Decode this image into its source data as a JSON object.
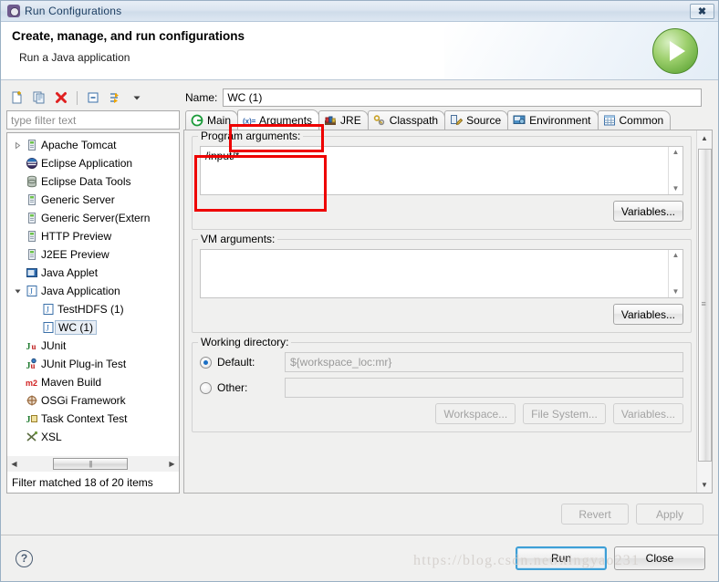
{
  "window": {
    "title": "Run Configurations",
    "close_label": "✖",
    "app_icon": "gear-icon"
  },
  "banner": {
    "title": "Create, manage, and run configurations",
    "subtitle": "Run a Java application",
    "badge_icon": "run-play-icon"
  },
  "tree_toolbar": {
    "buttons": [
      {
        "name": "new-configuration-button",
        "icon": "new-document-icon"
      },
      {
        "name": "duplicate-configuration-button",
        "icon": "copy-icon"
      },
      {
        "name": "delete-configuration-button",
        "icon": "delete-x-icon"
      },
      {
        "name": "collapse-all-button",
        "icon": "collapse-all-icon"
      },
      {
        "name": "filter-button",
        "icon": "filter-arrow-icon"
      },
      {
        "name": "view-menu-button",
        "icon": "chevron-down-icon"
      }
    ]
  },
  "filter": {
    "placeholder": "type filter text",
    "value": ""
  },
  "tree": {
    "items": [
      {
        "label": "Apache Tomcat",
        "icon": "server-icon",
        "indent": 0,
        "twisty": "collapsed",
        "selected": false
      },
      {
        "label": "Eclipse Application",
        "icon": "eclipse-icon",
        "indent": 0,
        "twisty": "none",
        "selected": false
      },
      {
        "label": "Eclipse Data Tools",
        "icon": "database-icon",
        "indent": 0,
        "twisty": "none",
        "selected": false
      },
      {
        "label": "Generic Server",
        "icon": "server-icon",
        "indent": 0,
        "twisty": "none",
        "selected": false
      },
      {
        "label": "Generic Server(Extern",
        "icon": "server-icon",
        "indent": 0,
        "twisty": "none",
        "selected": false
      },
      {
        "label": "HTTP Preview",
        "icon": "server-icon",
        "indent": 0,
        "twisty": "none",
        "selected": false
      },
      {
        "label": "J2EE Preview",
        "icon": "server-icon",
        "indent": 0,
        "twisty": "none",
        "selected": false
      },
      {
        "label": "Java Applet",
        "icon": "java-applet-icon",
        "indent": 0,
        "twisty": "none",
        "selected": false
      },
      {
        "label": "Java Application",
        "icon": "java-app-icon",
        "indent": 0,
        "twisty": "expanded",
        "selected": false
      },
      {
        "label": "TestHDFS (1)",
        "icon": "java-app-icon",
        "indent": 1,
        "twisty": "none",
        "selected": false
      },
      {
        "label": "WC (1)",
        "icon": "java-app-icon",
        "indent": 1,
        "twisty": "none",
        "selected": true
      },
      {
        "label": "JUnit",
        "icon": "junit-icon",
        "indent": 0,
        "twisty": "none",
        "selected": false
      },
      {
        "label": "JUnit Plug-in Test",
        "icon": "junit-plugin-icon",
        "indent": 0,
        "twisty": "none",
        "selected": false
      },
      {
        "label": "Maven Build",
        "icon": "maven-m2-icon",
        "indent": 0,
        "twisty": "none",
        "selected": false
      },
      {
        "label": "OSGi Framework",
        "icon": "osgi-icon",
        "indent": 0,
        "twisty": "none",
        "selected": false
      },
      {
        "label": "Task Context Test",
        "icon": "task-context-icon",
        "indent": 0,
        "twisty": "none",
        "selected": false
      },
      {
        "label": "XSL",
        "icon": "xsl-icon",
        "indent": 0,
        "twisty": "none",
        "selected": false
      }
    ],
    "status": "Filter matched 18 of 20 items"
  },
  "config": {
    "name_label": "Name:",
    "name_value": "WC (1)"
  },
  "tabs": [
    {
      "label": "Main",
      "icon": "main-green-circle-icon",
      "active": false
    },
    {
      "label": "Arguments",
      "icon": "arguments-xeq-icon",
      "active": true
    },
    {
      "label": "JRE",
      "icon": "jre-books-icon",
      "active": false
    },
    {
      "label": "Classpath",
      "icon": "classpath-keys-icon",
      "active": false
    },
    {
      "label": "Source",
      "icon": "source-pencil-icon",
      "active": false
    },
    {
      "label": "Environment",
      "icon": "environment-icon",
      "active": false
    },
    {
      "label": "Common",
      "icon": "common-table-icon",
      "active": false
    }
  ],
  "arguments_tab": {
    "program_args": {
      "label": "Program arguments:",
      "value": "/input/*",
      "variables_button": "Variables..."
    },
    "vm_args": {
      "label": "VM arguments:",
      "value": "",
      "variables_button": "Variables..."
    },
    "working_directory": {
      "label": "Working directory:",
      "default_label": "Default:",
      "default_value": "${workspace_loc:mr}",
      "default_selected": true,
      "other_label": "Other:",
      "other_value": "",
      "other_selected": false,
      "workspace_button": "Workspace...",
      "filesystem_button": "File System...",
      "variables_button": "Variables..."
    }
  },
  "footer": {
    "revert_label": "Revert",
    "apply_label": "Apply",
    "help_label": "?",
    "run_label": "Run",
    "close_label": "Close"
  },
  "watermark": "https://blog.csdn.net/xingyao231",
  "colors": {
    "accent_blue": "#3e9fd6",
    "annotation_red": "#ee0000",
    "run_green": "#63a83a",
    "dialog_bg": "#f0f0ef",
    "title_blue": "#1e3f63"
  }
}
